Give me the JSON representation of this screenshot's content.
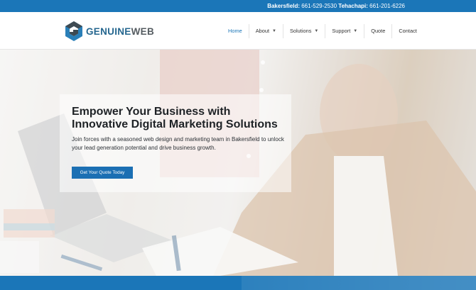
{
  "topbar": {
    "bakersfield_label": "Bakersfield:",
    "bakersfield_phone": "661-529-2530",
    "tehachapi_label": "Tehachapi:",
    "tehachapi_phone": "661-201-6226"
  },
  "logo": {
    "word_main": "GENUINE",
    "word_accent": "WEB",
    "icon": "hexagon-g-logo"
  },
  "nav": {
    "home": "Home",
    "about": "About",
    "solutions": "Solutions",
    "support": "Support",
    "quote": "Quote",
    "contact": "Contact",
    "caret_icon": "chevron-down-icon"
  },
  "hero": {
    "headline": "Empower Your Business with Innovative Digital Marketing Solutions",
    "body": "Join forces with a seasoned web design and marketing team in Bakersfield to unlock your lead generation potential and drive business growth.",
    "cta_label": "Get Your Quote Today"
  },
  "colors": {
    "brand_blue": "#1b76b8",
    "logo_blue": "#26678f",
    "logo_gray": "#555c61"
  }
}
